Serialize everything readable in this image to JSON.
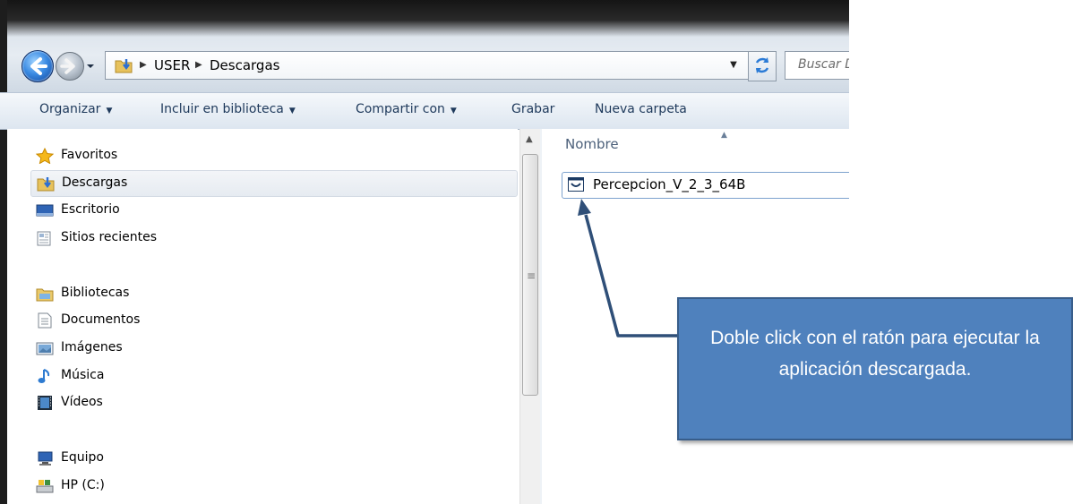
{
  "breadcrumb": {
    "items": [
      "USER",
      "Descargas"
    ]
  },
  "search": {
    "placeholder": "Buscar Descargas"
  },
  "toolbar": {
    "items": [
      {
        "label": "Organizar",
        "has_dropdown": true
      },
      {
        "label": "Incluir en biblioteca",
        "has_dropdown": true
      },
      {
        "label": "Compartir con",
        "has_dropdown": true
      },
      {
        "label": "Grabar",
        "has_dropdown": false
      },
      {
        "label": "Nueva carpeta",
        "has_dropdown": false
      }
    ]
  },
  "nav": {
    "favorites": {
      "label": "Favoritos",
      "icon": "star-icon",
      "items": [
        {
          "label": "Descargas",
          "icon": "downloads-folder-icon",
          "selected": true
        },
        {
          "label": "Escritorio",
          "icon": "desktop-icon"
        },
        {
          "label": "Sitios recientes",
          "icon": "recent-places-icon"
        }
      ]
    },
    "libraries": {
      "label": "Bibliotecas",
      "icon": "libraries-icon",
      "items": [
        {
          "label": "Documentos",
          "icon": "document-icon"
        },
        {
          "label": "Imágenes",
          "icon": "pictures-icon"
        },
        {
          "label": "Música",
          "icon": "music-icon"
        },
        {
          "label": "Vídeos",
          "icon": "videos-icon"
        }
      ]
    },
    "computer": {
      "label": "Equipo",
      "icon": "computer-icon",
      "items": [
        {
          "label": "HP (C:)",
          "icon": "drive-icon"
        }
      ]
    }
  },
  "content": {
    "column_header": "Nombre",
    "files": [
      {
        "name": "Percepcion_V_2_3_64B",
        "icon": "application-icon"
      }
    ]
  },
  "callout": {
    "text": "Doble click con el ratón para ejecutar la aplicación descargada."
  },
  "colors": {
    "callout_fill": "#4f81bd",
    "callout_border": "#385d8a",
    "toolbar_text": "#1e395b",
    "arrow": "#2f4f78"
  }
}
